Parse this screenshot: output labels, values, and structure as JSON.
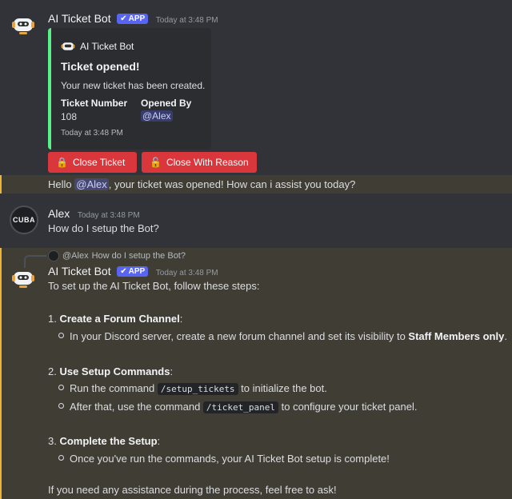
{
  "message1": {
    "username": "AI Ticket Bot",
    "badge": "APP",
    "timestamp": "Today at 3:48 PM",
    "embed": {
      "author": "AI Ticket Bot",
      "title": "Ticket opened!",
      "description": "Your new ticket has been created.",
      "field1_name": "Ticket Number",
      "field1_value": "108",
      "field2_name": "Opened By",
      "field2_value": "@Alex",
      "footer": "Today at 3:48 PM",
      "accent_color": "#57f287"
    },
    "buttons": {
      "close_ticket": "Close Ticket",
      "close_with_reason": "Close With Reason"
    }
  },
  "message2": {
    "part1": "Hello ",
    "mention": "@Alex",
    "part2": ", your ticket was opened! How can i assist you today?"
  },
  "message3": {
    "username": "Alex",
    "timestamp": "Today at 3:48 PM",
    "text": "How do I setup the Bot?",
    "avatar_text": "CUBA"
  },
  "message4": {
    "reply_mention": "@Alex",
    "reply_text": "How do I setup the Bot?",
    "username": "AI Ticket Bot",
    "badge": "APP",
    "timestamp": "Today at 3:48 PM",
    "intro": "To set up the AI Ticket Bot, follow these steps:",
    "step1_num": "1.",
    "step1_title": "Create a Forum Channel",
    "step1_colon": ":",
    "step1_bullet_a": "In your Discord server, create a new forum channel and set its visibility to ",
    "step1_bullet_bold": "Staff Members only",
    "step1_bullet_end": ".",
    "step2_num": "2.",
    "step2_title": "Use Setup Commands",
    "step2_colon": ":",
    "step2_b1_a": "Run the command ",
    "step2_b1_code": "/setup_tickets",
    "step2_b1_b": " to initialize the bot.",
    "step2_b2_a": "After that, use the command ",
    "step2_b2_code": "/ticket_panel",
    "step2_b2_b": " to configure your ticket panel.",
    "step3_num": "3.",
    "step3_title": "Complete the Setup",
    "step3_colon": ":",
    "step3_b1": "Once you've run the commands, your AI Ticket Bot setup is complete!",
    "outro": "If you need any assistance during the process, feel free to ask!"
  },
  "colors": {
    "background": "#313338",
    "embed_bg": "#2b2d31",
    "button_red": "#da373c",
    "badge_blurple": "#5865f2",
    "highlight_bg": "#403d35",
    "highlight_bar": "#f0b232"
  },
  "icons": [
    "bot-avatar-icon",
    "check-icon",
    "lock-icon",
    "unlock-icon",
    "reply-icon"
  ]
}
